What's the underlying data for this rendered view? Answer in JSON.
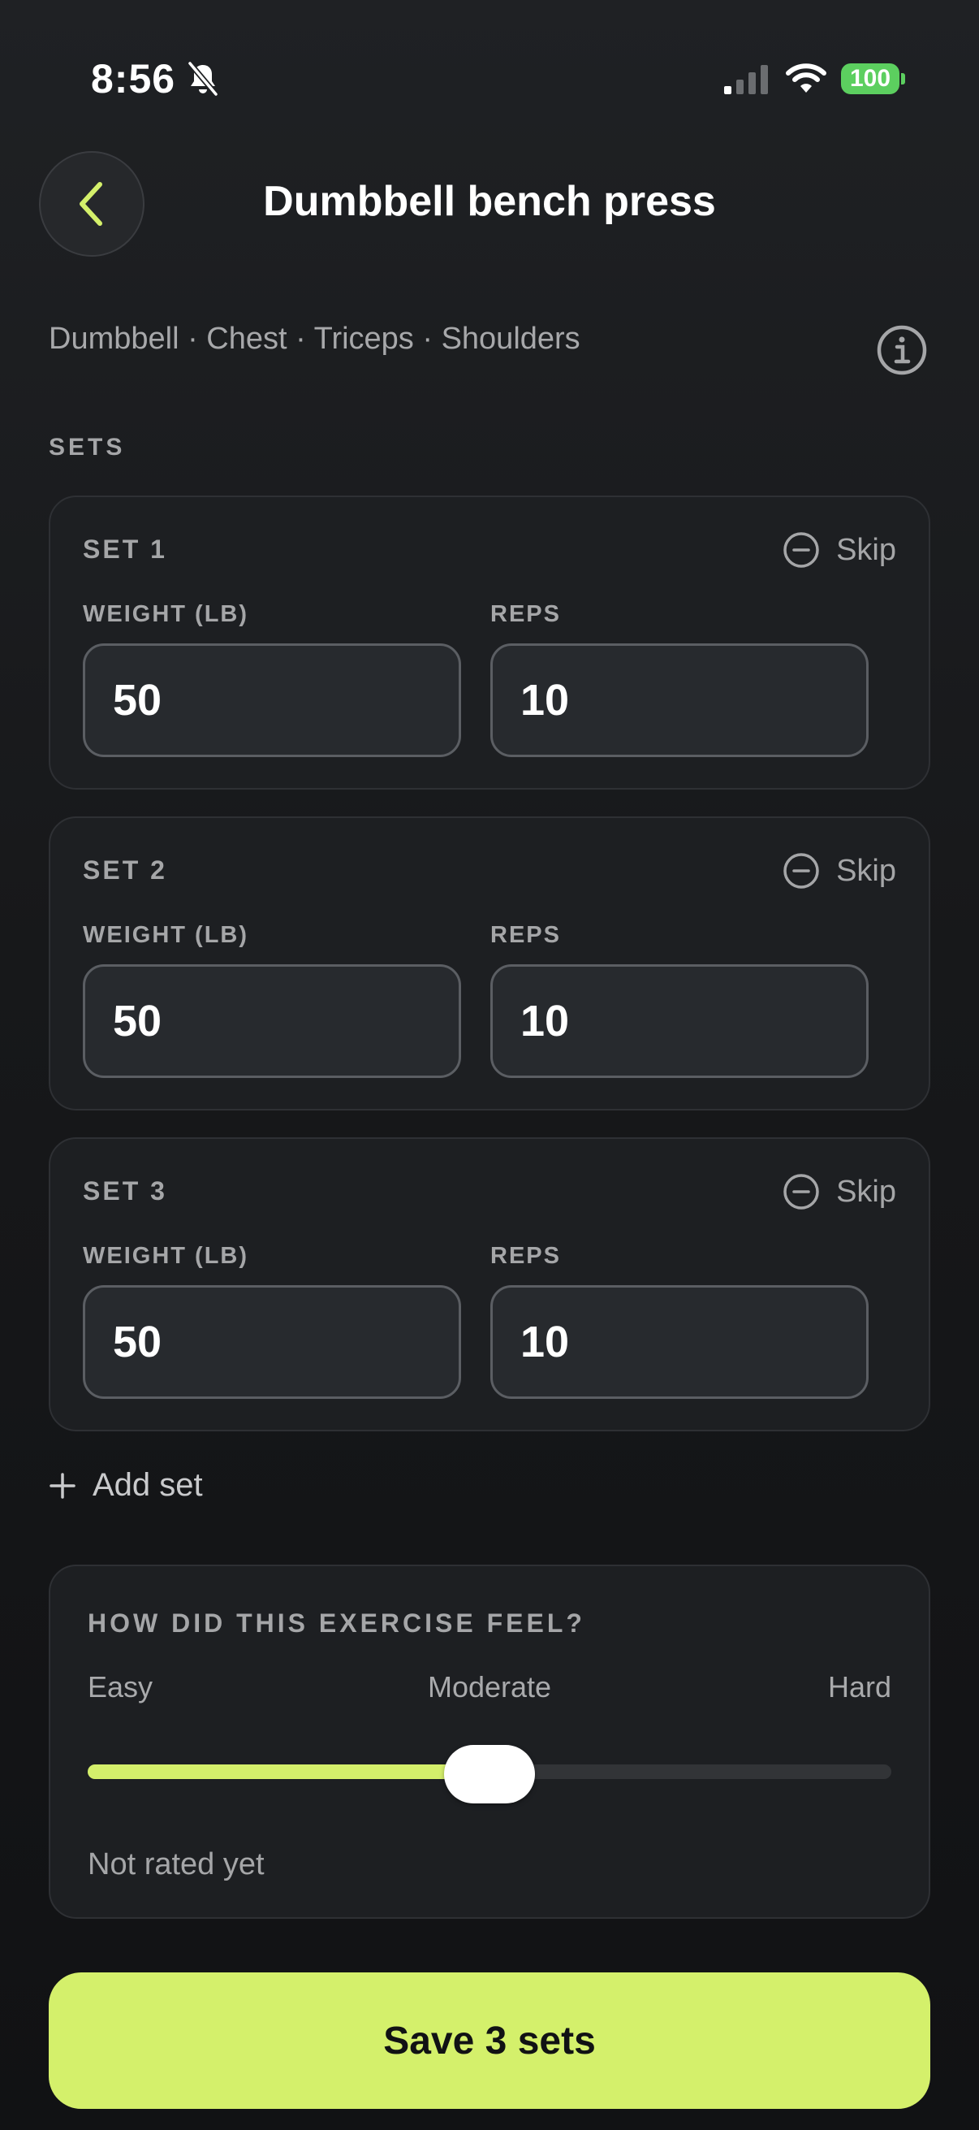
{
  "status_bar": {
    "time": "8:56",
    "battery": "100",
    "silent_icon": "bell-slash-icon",
    "signal_icon": "cellular-signal-icon",
    "wifi_icon": "wifi-icon"
  },
  "header": {
    "back_icon": "chevron-left-icon",
    "title": "Dumbbell bench press"
  },
  "exercise": {
    "muscles": "Dumbbell · Chest · Triceps · Shoulders",
    "info_icon": "info-icon"
  },
  "sets_section": {
    "label": "SETS",
    "sets": [
      {
        "title": "SET 1",
        "skip_label": "Skip",
        "weight_label": "WEIGHT (LB)",
        "reps_label": "REPS",
        "weight": "50",
        "reps": "10"
      },
      {
        "title": "SET 2",
        "skip_label": "Skip",
        "weight_label": "WEIGHT (LB)",
        "reps_label": "REPS",
        "weight": "50",
        "reps": "10"
      },
      {
        "title": "SET 3",
        "skip_label": "Skip",
        "weight_label": "WEIGHT (LB)",
        "reps_label": "REPS",
        "weight": "50",
        "reps": "10"
      }
    ],
    "add_set_label": "Add set"
  },
  "feel": {
    "title": "HOW DID THIS EXERCISE FEEL?",
    "easy_label": "Easy",
    "moderate_label": "Moderate",
    "hard_label": "Hard",
    "slider_value": 0.5,
    "status": "Not rated yet"
  },
  "colors": {
    "accent": "#d4f06b",
    "background": "#17181a",
    "card": "#1d1f22",
    "battery": "#5ccf5f"
  },
  "save_button": {
    "label": "Save 3 sets"
  }
}
